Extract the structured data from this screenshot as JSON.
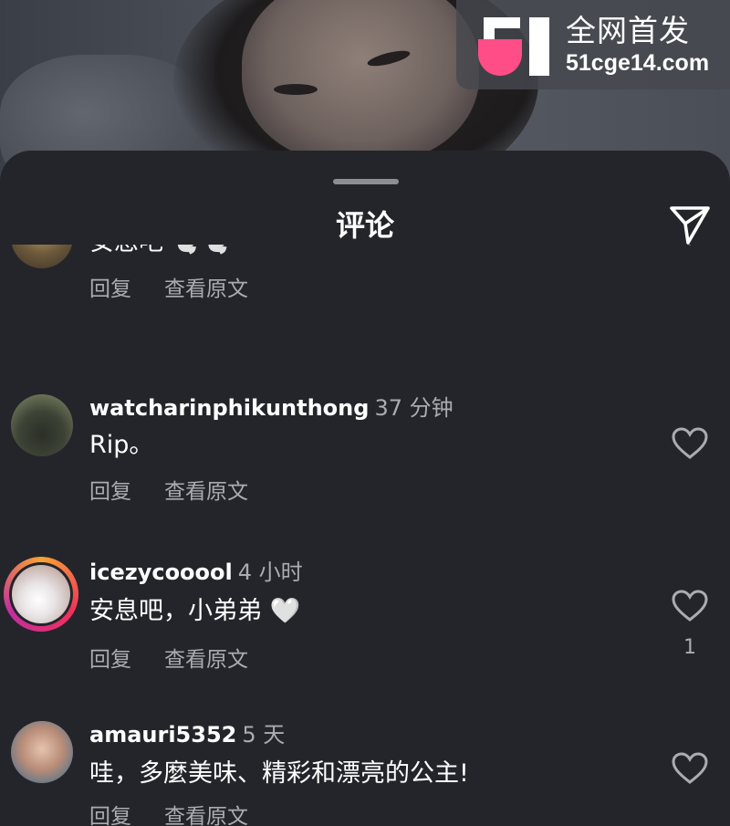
{
  "watermark": {
    "line1": "全网首发",
    "line2": "51cge14.com"
  },
  "sheet": {
    "title": "评论"
  },
  "comments": [
    {
      "username": "",
      "time": "",
      "text": "安息吧 🕊️🕊️",
      "reply": "回复",
      "translate": "查看原文",
      "likes": ""
    },
    {
      "username": "watcharinphikunthong",
      "time": "37 分钟",
      "text": "Rip。",
      "reply": "回复",
      "translate": "查看原文",
      "likes": ""
    },
    {
      "username": "icezycooool",
      "time": "4 小时",
      "text": "安息吧，小弟弟 🤍",
      "reply": "回复",
      "translate": "查看原文",
      "likes": "1"
    },
    {
      "username": "amauri5352",
      "time": "5 天",
      "text": "哇，多麼美味、精彩和漂亮的公主!",
      "reply": "回复",
      "translate": "查看原文",
      "likes": ""
    }
  ],
  "colors": {
    "background": "#23252a",
    "secondary_text": "#a9acb2",
    "story_ring": "#f0305b",
    "logo_pink": "#ff4d88"
  },
  "icons": [
    "send-icon",
    "heart-icon",
    "red-heart-emoji",
    "white-heart-emoji",
    "dove-emoji"
  ]
}
